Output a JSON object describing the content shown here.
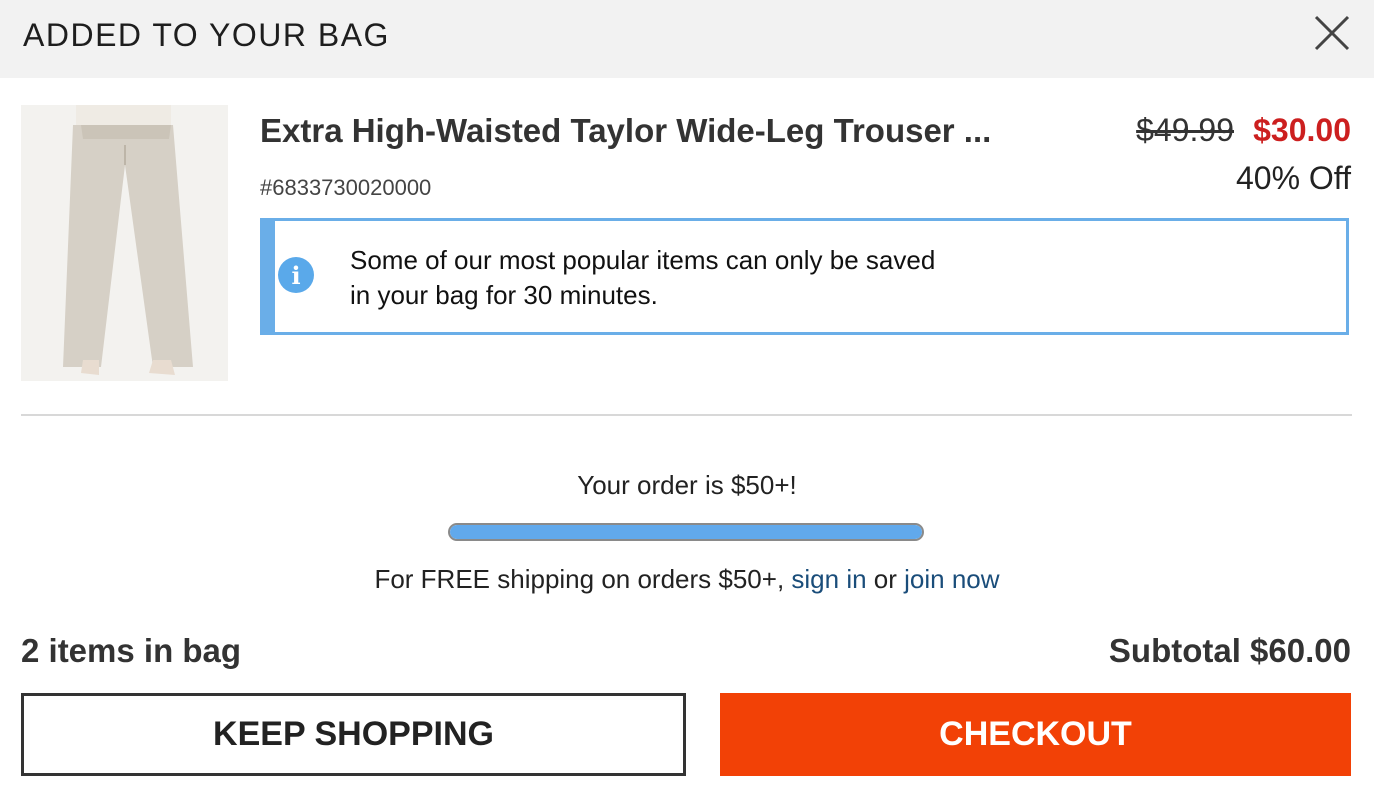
{
  "header": {
    "title": "ADDED TO YOUR BAG",
    "close_icon": "close-icon"
  },
  "product": {
    "name": "Extra High-Waisted Taylor Wide-Leg Trouser ...",
    "sku": "#6833730020000",
    "original_price": "$49.99",
    "sale_price": "$30.00",
    "discount": "40% Off"
  },
  "notice": {
    "icon": "info-icon",
    "line1": "Some of our most popular items can only be saved",
    "line2": "in your bag for 30 minutes."
  },
  "shipping": {
    "order_message": "Your order is $50+!",
    "progress_percent": 100,
    "prefix": "For FREE shipping on orders $50+, ",
    "sign_in": "sign in",
    "or": " or ",
    "join_now": "join now"
  },
  "summary": {
    "items": "2 items in bag",
    "subtotal": "Subtotal $60.00"
  },
  "buttons": {
    "keep_shopping": "KEEP SHOPPING",
    "checkout": "CHECKOUT"
  },
  "colors": {
    "accent": "#f24106",
    "sale": "#cc1f1f",
    "info": "#6aaee8",
    "link": "#1a4d7a"
  }
}
